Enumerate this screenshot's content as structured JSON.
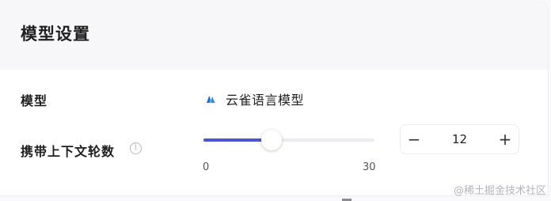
{
  "settings": {
    "title": "模型设置",
    "model": {
      "label": "模型",
      "value": "云雀语言模型",
      "icon": "yunque-model-logo-icon"
    },
    "context_rounds": {
      "label": "携带上下文轮数",
      "info_icon": "info-circle-icon",
      "slider_min": "0",
      "slider_max": "30",
      "value": 12,
      "value_text": "12",
      "decrement_label": "−",
      "increment_label": "+"
    }
  },
  "watermark": "@稀土掘金技术社区",
  "colors": {
    "accent": "#4a55d8",
    "logo": "#1f6fe0",
    "header_bg": "#f7f7f9"
  }
}
